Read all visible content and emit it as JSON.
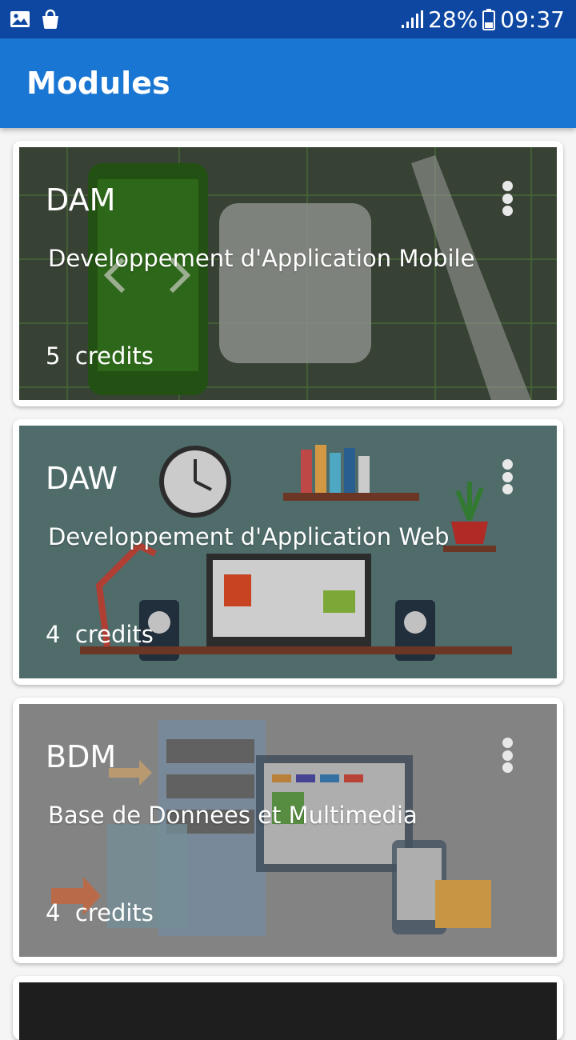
{
  "status_bar": {
    "signal_icon": "signal-icon",
    "battery_percent": "28%",
    "time": "09:37"
  },
  "app_bar": {
    "title": "Modules"
  },
  "modules": [
    {
      "code": "DAM",
      "name": "Developpement d'Application Mobile",
      "credits": "5  credits",
      "overlay_color": "#3d4a3a"
    },
    {
      "code": "DAW",
      "name": "Developpement d'Application Web",
      "credits": "4  credits",
      "overlay_color": "#587776"
    },
    {
      "code": "BDM",
      "name": "Base de Donnees et Multimedia",
      "credits": "4  credits",
      "overlay_color": "#8a8a8a"
    }
  ]
}
